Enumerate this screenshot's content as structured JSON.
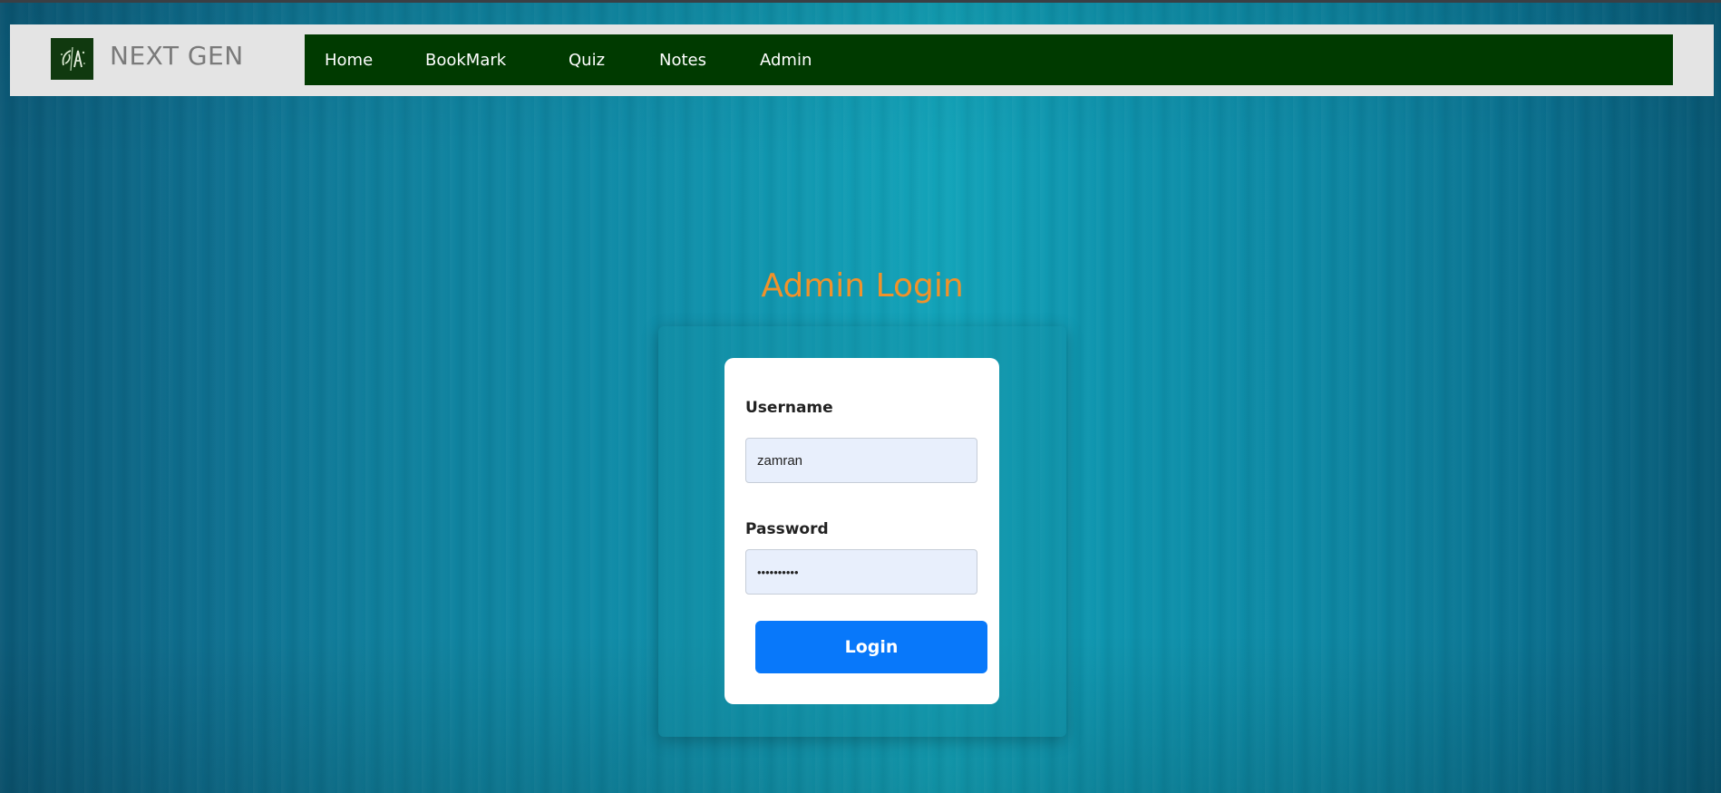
{
  "header": {
    "logo_icon": "plant-logo-icon",
    "brand": "NEXT GEN"
  },
  "nav": {
    "items": [
      {
        "label": "Home"
      },
      {
        "label": "BookMark"
      },
      {
        "label": "Quiz"
      },
      {
        "label": "Notes"
      },
      {
        "label": "Admin"
      }
    ]
  },
  "login": {
    "title": "Admin Login",
    "username_label": "Username",
    "username_value": "zamran",
    "password_label": "Password",
    "password_value": "••••••••••",
    "button_label": "Login"
  },
  "colors": {
    "nav_bg": "#003a00",
    "title": "#f0922b",
    "button": "#0878fa",
    "input_bg": "#e8effc"
  }
}
